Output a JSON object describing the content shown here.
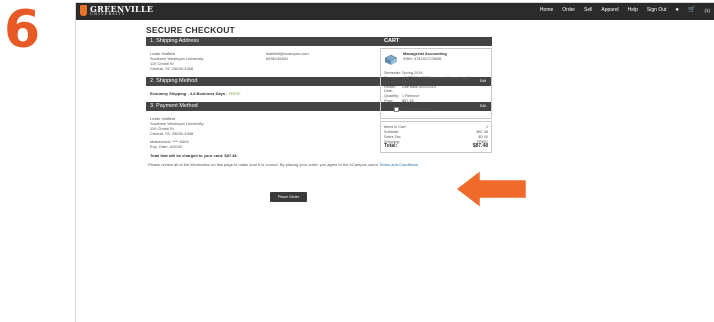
{
  "step": "6",
  "header": {
    "logo_main": "GREENVILLE",
    "logo_sub": "UNIVERSITY",
    "nav": [
      "Home",
      "Order",
      "Sell",
      "Apparel",
      "Help",
      "Sign Out"
    ],
    "cart_count": "(1)"
  },
  "checkout": {
    "title": "SECURE CHECKOUT",
    "edit_label": "Edit",
    "shipping_address": {
      "heading": "1. Shipping Address",
      "lines": [
        "Leslie Hatfield",
        "Southern Wesleyan University",
        "119 Christi St",
        "Central, SC 29630-4308"
      ],
      "email": "lhatfield@ecampus.com",
      "phone": "8595146651"
    },
    "shipping_method": {
      "heading": "2. Shipping Method",
      "method": "Economy Shipping - 4-8 Business Days - ",
      "price": "FREE!"
    },
    "payment_method": {
      "heading": "3. Payment Method",
      "lines": [
        "Leslie Hatfield",
        "Southern Wesleyan University",
        "119 Christi St",
        "Central, SC 29630-4308"
      ],
      "card": "Mastercard: ****-5454",
      "exp": "Exp. Date: 4/2020",
      "charge": "Total that will be charged to your card: $87.48"
    },
    "notice_text": "Please review all of the information on this page to make sure it is correct. By placing your order, you agree to the eCampus.com's ",
    "notice_link": "Terms and Conditions.",
    "place_order": "Place Order"
  },
  "cart": {
    "heading": "CART",
    "item": {
      "title": "Managerial Accounting",
      "isbn": "ISBN: 9781307276656",
      "details": [
        {
          "k": "Semester:",
          "v": "Spring 2019"
        },
        {
          "k": "Course:",
          "v": "ACCT 201-01 Principles of Accounting II"
        },
        {
          "k": "Condition:",
          "v": "RENTAL"
        },
        {
          "k": "Return Date:",
          "v": "Due back 5/20/2019"
        },
        {
          "k": "Quantity:",
          "v": "1 Remove"
        },
        {
          "k": "Price:",
          "v": "$87.48"
        }
      ],
      "pickup_label": "Customer Pickup"
    },
    "totals": [
      {
        "label": "Items in Cart:",
        "value": "1"
      },
      {
        "label": "Subtotal:",
        "value": "$87.48"
      },
      {
        "label": "Sales Tax:",
        "value": "$0.00"
      },
      {
        "label": "Shipping:",
        "value": "FREE!"
      }
    ],
    "total_label": "Total:",
    "total_value": "$87.48"
  },
  "colors": {
    "accent": "#e85a25",
    "header_bg": "#2b2b2b",
    "section_bg": "#444444",
    "free_green": "#7aa24a"
  },
  "icons": [
    "user-icon",
    "cart-icon",
    "book-icon",
    "arrow-icon"
  ]
}
